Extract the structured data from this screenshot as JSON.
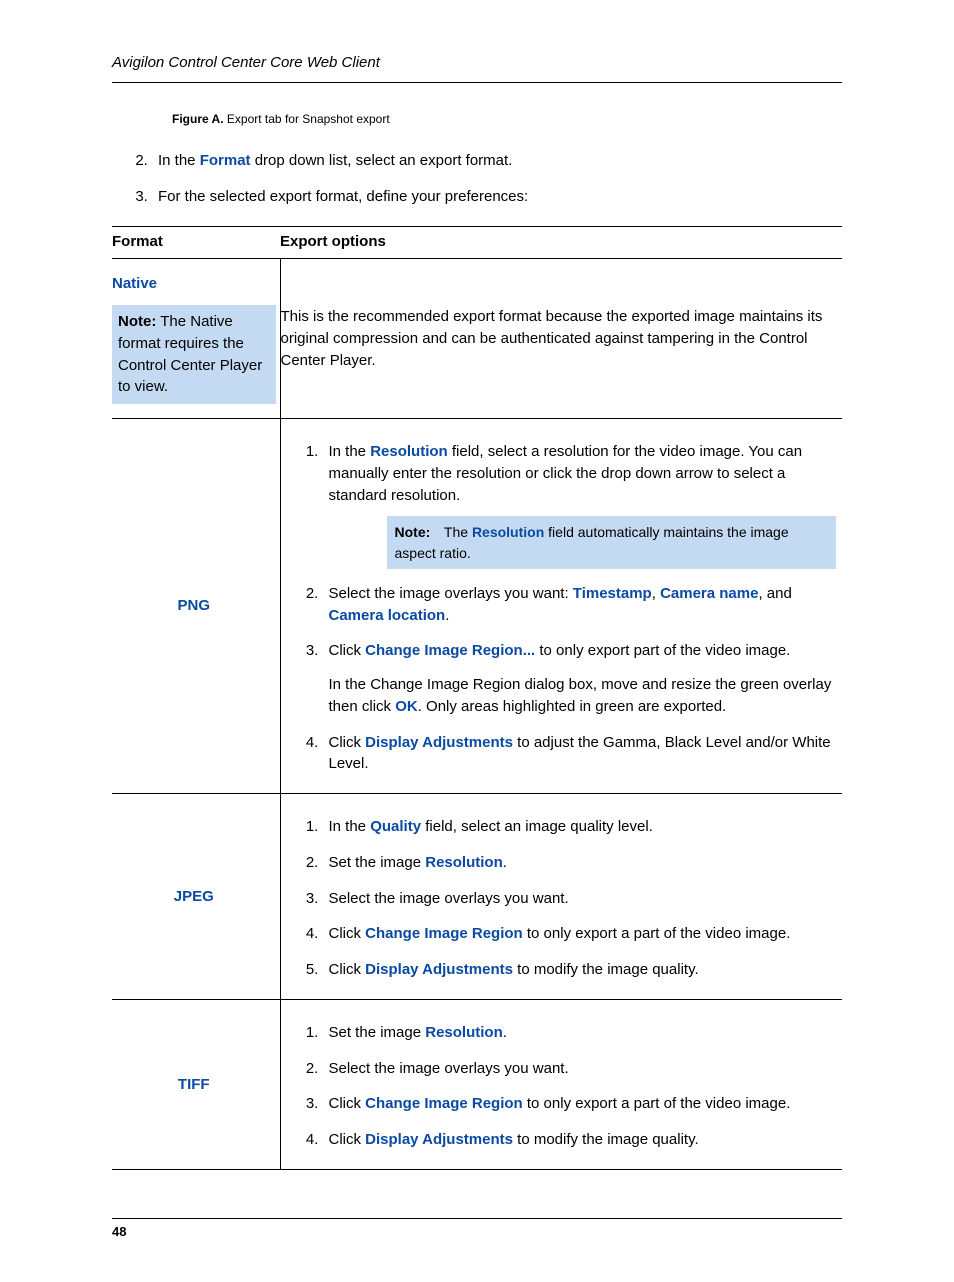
{
  "header": {
    "title": "Avigilon Control Center Core Web Client"
  },
  "figure": {
    "label": "Figure A.",
    "caption": "Export tab for Snapshot export"
  },
  "intro": {
    "step2_pre": "In the ",
    "step2_kw": "Format",
    "step2_post": " drop down list, select an export format.",
    "step3": "For the selected export format, define your preferences:"
  },
  "table": {
    "head": {
      "c1": "Format",
      "c2": "Export options"
    },
    "native": {
      "name": "Native",
      "note_label": "Note:",
      "note_body": "The Native format requires the Control Center Player to view.",
      "desc": "This is the recommended export format because the exported image maintains its original compression and can be authenticated against tampering in the Control Center Player."
    },
    "png": {
      "name": "PNG",
      "s1_a": "In the ",
      "s1_kw": "Resolution",
      "s1_b": " field, select a resolution for the video image. You can manually enter the resolution or click the drop down arrow to select a standard resolution.",
      "note_label": "Note:",
      "note_a": "The ",
      "note_kw": "Resolution",
      "note_b": " field automatically maintains the image aspect ratio.",
      "s2_a": "Select the image overlays you want: ",
      "s2_kw1": "Timestamp",
      "s2_sep1": ", ",
      "s2_kw2": "Camera name",
      "s2_sep2": ", and ",
      "s2_kw3": "Camera location",
      "s2_end": ".",
      "s3_a": "Click ",
      "s3_kw": "Change Image Region...",
      "s3_b": " to only export part of the video image.",
      "s3_sub_a": "In the Change Image Region dialog box, move and resize the green overlay then click ",
      "s3_sub_kw": "OK",
      "s3_sub_b": ". Only areas highlighted in green are exported.",
      "s4_a": "Click ",
      "s4_kw": "Display Adjustments",
      "s4_b": " to adjust the Gamma, Black Level and/or White Level."
    },
    "jpeg": {
      "name": "JPEG",
      "s1_a": "In the ",
      "s1_kw": "Quality",
      "s1_b": " field, select an image quality level.",
      "s2_a": "Set the image ",
      "s2_kw": "Resolution",
      "s2_b": ".",
      "s3": "Select the image overlays you want.",
      "s4_a": "Click ",
      "s4_kw": "Change Image Region",
      "s4_b": " to only export a part of the video image.",
      "s5_a": "Click ",
      "s5_kw": "Display Adjustments",
      "s5_b": " to modify the image quality."
    },
    "tiff": {
      "name": "TIFF",
      "s1_a": "Set the image ",
      "s1_kw": "Resolution",
      "s1_b": ".",
      "s2": "Select the image overlays you want.",
      "s3_a": "Click ",
      "s3_kw": "Change Image Region",
      "s3_b": " to only export a part of the video image.",
      "s4_a": "Click ",
      "s4_kw": "Display Adjustments",
      "s4_b": " to modify the image quality."
    }
  },
  "footer": {
    "page": "48"
  }
}
